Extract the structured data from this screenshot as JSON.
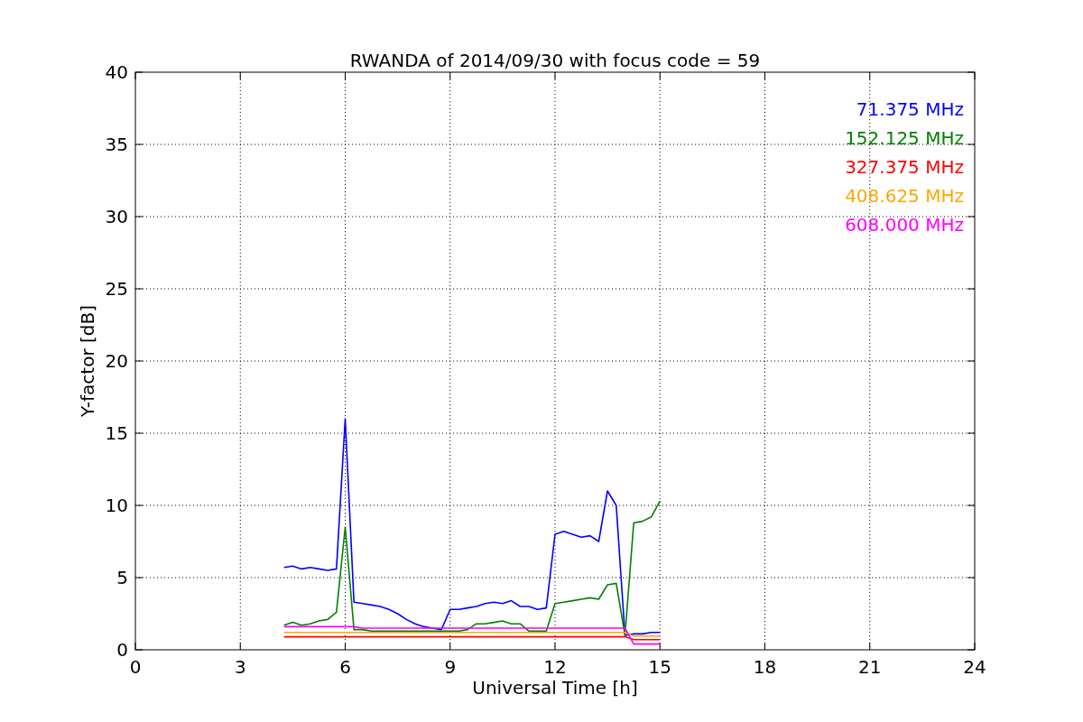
{
  "figure": {
    "chart_data": {
      "type": "line",
      "title": "RWANDA of 2014/09/30 with focus code = 59",
      "xlabel": "Universal Time [h]",
      "ylabel": "Y-factor [dB]",
      "x": [
        4.25,
        4.5,
        4.75,
        5,
        5.25,
        5.5,
        5.75,
        6,
        6.25,
        6.5,
        6.75,
        7,
        7.25,
        7.5,
        7.75,
        8,
        8.25,
        8.5,
        8.75,
        9,
        9.25,
        9.5,
        9.75,
        10,
        10.25,
        10.5,
        10.75,
        11,
        11.25,
        11.5,
        11.75,
        12,
        12.25,
        12.5,
        12.75,
        13,
        13.25,
        13.5,
        13.75,
        14,
        14.25,
        14.5,
        14.75,
        15
      ],
      "series": [
        {
          "name": "71.375 MHz",
          "color": "#0000ff",
          "values": [
            5.7,
            5.8,
            5.6,
            5.7,
            5.6,
            5.5,
            5.6,
            16.0,
            3.3,
            3.2,
            3.1,
            3.0,
            2.8,
            2.5,
            2.1,
            1.8,
            1.6,
            1.5,
            1.4,
            2.8,
            2.8,
            2.9,
            3.0,
            3.2,
            3.3,
            3.2,
            3.4,
            3.0,
            3.0,
            2.8,
            2.9,
            8.0,
            8.2,
            8.0,
            7.8,
            7.9,
            7.5,
            11.0,
            10.0,
            1.0,
            1.1,
            1.1,
            1.2,
            1.2
          ]
        },
        {
          "name": "152.125 MHz",
          "color": "#008000",
          "values": [
            1.7,
            1.9,
            1.7,
            1.8,
            2.0,
            2.1,
            2.6,
            8.5,
            1.4,
            1.4,
            1.3,
            1.3,
            1.3,
            1.3,
            1.3,
            1.3,
            1.3,
            1.3,
            1.3,
            1.3,
            1.3,
            1.4,
            1.8,
            1.8,
            1.9,
            2.0,
            1.8,
            1.8,
            1.3,
            1.3,
            1.3,
            3.2,
            3.3,
            3.4,
            3.5,
            3.6,
            3.5,
            4.5,
            4.6,
            1.0,
            8.8,
            8.9,
            9.2,
            10.3
          ]
        },
        {
          "name": "327.375 MHz",
          "color": "#ff0000",
          "values": [
            0.9,
            0.9,
            0.9,
            0.9,
            0.9,
            0.9,
            0.9,
            0.9,
            0.9,
            0.9,
            0.9,
            0.9,
            0.9,
            0.9,
            0.9,
            0.9,
            0.9,
            0.9,
            0.9,
            0.9,
            0.9,
            0.9,
            0.9,
            0.9,
            0.9,
            0.9,
            0.9,
            0.9,
            0.9,
            0.9,
            0.9,
            0.9,
            0.9,
            0.9,
            0.9,
            0.9,
            0.9,
            0.9,
            0.9,
            0.9,
            0.7,
            0.7,
            0.7,
            0.7
          ]
        },
        {
          "name": "408.625 MHz",
          "color": "#ffa500",
          "values": [
            1.2,
            1.2,
            1.2,
            1.2,
            1.2,
            1.2,
            1.2,
            1.2,
            1.2,
            1.2,
            1.2,
            1.2,
            1.2,
            1.2,
            1.2,
            1.2,
            1.2,
            1.2,
            1.2,
            1.2,
            1.2,
            1.2,
            1.2,
            1.2,
            1.2,
            1.2,
            1.2,
            1.2,
            1.2,
            1.2,
            1.2,
            1.2,
            1.2,
            1.2,
            1.2,
            1.2,
            1.2,
            1.2,
            1.2,
            1.2,
            0.95,
            0.95,
            0.95,
            0.95
          ]
        },
        {
          "name": "608.000 MHz",
          "color": "#ff00ff",
          "values": [
            1.6,
            1.6,
            1.6,
            1.6,
            1.6,
            1.6,
            1.6,
            1.6,
            1.6,
            1.5,
            1.5,
            1.5,
            1.5,
            1.5,
            1.5,
            1.5,
            1.5,
            1.5,
            1.5,
            1.5,
            1.5,
            1.5,
            1.5,
            1.5,
            1.5,
            1.5,
            1.5,
            1.5,
            1.5,
            1.5,
            1.5,
            1.5,
            1.5,
            1.5,
            1.5,
            1.5,
            1.5,
            1.5,
            1.5,
            1.5,
            0.4,
            0.4,
            0.4,
            0.4
          ]
        }
      ],
      "grid": true,
      "xlim": [
        0,
        24
      ],
      "ylim": [
        0,
        40
      ],
      "xticks": [
        0,
        3,
        6,
        9,
        12,
        15,
        18,
        21,
        24
      ],
      "yticks": [
        0,
        5,
        10,
        15,
        20,
        25,
        30,
        35,
        40
      ]
    }
  }
}
